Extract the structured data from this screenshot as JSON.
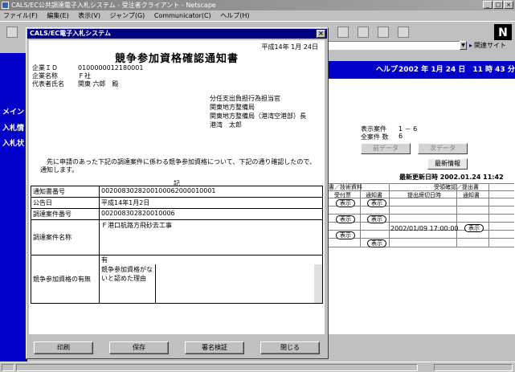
{
  "browser": {
    "title": "CALS/EC公共調達電子入札システム - 受注者クライアント - Netscape",
    "menu": [
      "ファイル(F)",
      "編集(E)",
      "表示(V)",
      "ジャンプ(G)",
      "Communicator(C)",
      "ヘルプ(H)"
    ],
    "related_sites": "関連サイト",
    "logo": "N"
  },
  "left_panel": {
    "items": [
      "メイン",
      "入札情",
      "入札状"
    ]
  },
  "bg_page": {
    "help": "ヘルプ",
    "datetime": "2002 年 1月 24 日　11 時 43 分",
    "display_label": "表示案件",
    "display_value": "1 － 6",
    "total_label": "全案件 数",
    "total_value": "6",
    "prev_btn": "前データ",
    "next_btn": "次データ",
    "latest_btn": "最新情報",
    "last_update": "最新更新日時 2002.01.24 11:42",
    "col_tech": "書／技術資料",
    "col_confirm": "受領確認／提出書",
    "col_receipt": "受付票",
    "col_notice": "通知書",
    "col_deadline": "提出締切日時",
    "col_notice2": "通知書",
    "show": "表示",
    "deadline_value": "2002/01/09 17:00:00"
  },
  "dialog": {
    "title": "CALS/EC電子入札システム",
    "close": "×",
    "doc_date": "平成14年 1月 24日",
    "doc_title": "競争参加資格確認通知書",
    "company_id_label": "企業ＩＤ",
    "company_id": "010000001218000​1",
    "company_name_label": "企業名称",
    "company_name": "Ｆ社",
    "rep_label": "代表者氏名",
    "rep_name": "関東 六郎　殿",
    "recipient_1": "分任支出負担行為担当官",
    "recipient_2": "関東地方整備局",
    "recipient_3": "関東地方整備局（港湾空港部）長",
    "recipient_4": "港湾　太郎",
    "body": "　先に申請のあった下記の調達案件に係わる競争参加資格について、下記の通り確認したので、通知します。",
    "ki": "記",
    "row1_label": "通知書番号",
    "row1_value": "002008302820010006200001000​1",
    "row2_label": "公告日",
    "row2_value": "平成14年1月2日",
    "row3_label": "調達案件番号",
    "row3_value": "002008302820010006",
    "row4_label": "調達案件名称",
    "row4_value": "Ｆ港口航路方飛砂去工事",
    "row5_label": "競争参加資格の有無",
    "row5_value": "有",
    "row5_sub_label": "競争参加資格がないと認めた理由",
    "btn_print": "印刷",
    "btn_save": "保存",
    "btn_verify": "署名検証",
    "btn_close": "閉じる"
  }
}
